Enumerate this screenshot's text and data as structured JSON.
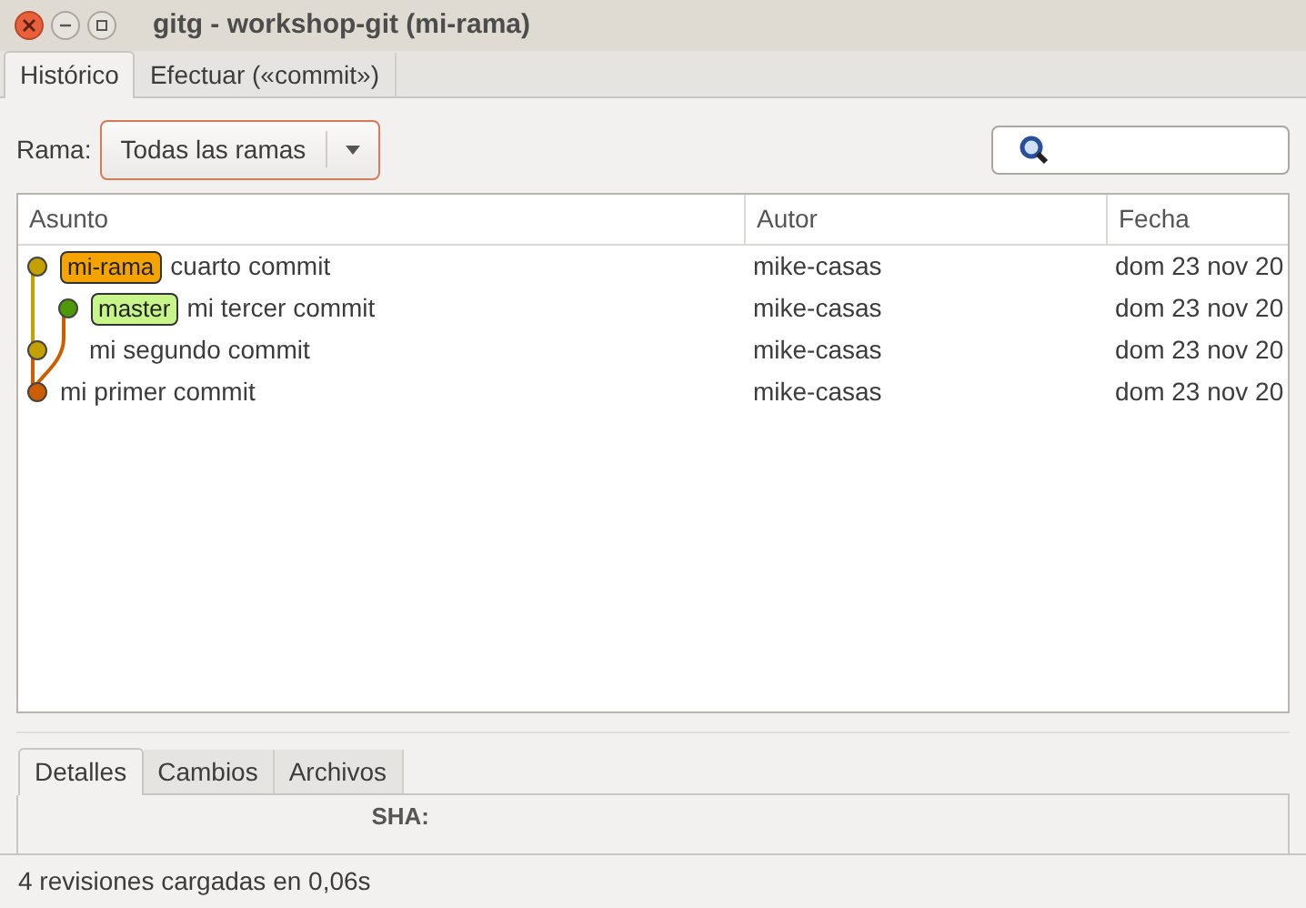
{
  "window": {
    "title": "gitg - workshop-git (mi-rama)"
  },
  "tabs": [
    {
      "label": "Histórico",
      "selected": true
    },
    {
      "label": "Efectuar («commit»)",
      "selected": false
    }
  ],
  "toolbar": {
    "branch_label": "Rama:",
    "branch_value": "Todas las ramas"
  },
  "table": {
    "columns": [
      "Asunto",
      "Autor",
      "Fecha"
    ],
    "rows": [
      {
        "kind": "main",
        "color": "#c4a000",
        "ref": {
          "label": "mi-rama",
          "color": "#f5a300"
        },
        "subject": "cuarto commit",
        "author": "mike-casas",
        "date": "dom 23 nov 20"
      },
      {
        "kind": "branch",
        "color": "#4e9a06",
        "ref": {
          "label": "master",
          "color": "#c8f58a"
        },
        "subject": "mi tercer commit",
        "author": "mike-casas",
        "date": "dom 23 nov 20"
      },
      {
        "kind": "main-beside-branch",
        "color": "#c4a000",
        "subject": "mi segundo commit",
        "author": "mike-casas",
        "date": "dom 23 nov 20"
      },
      {
        "kind": "main",
        "color": "#ce5c00",
        "subject": "mi primer commit",
        "author": "mike-casas",
        "date": "dom 23 nov 20"
      }
    ]
  },
  "details_tabs": [
    {
      "label": "Detalles",
      "selected": true
    },
    {
      "label": "Cambios",
      "selected": false
    },
    {
      "label": "Archivos",
      "selected": false
    }
  ],
  "details": {
    "sha_label": "SHA:"
  },
  "status_bar": "4 revisiones cargadas en 0,06s"
}
